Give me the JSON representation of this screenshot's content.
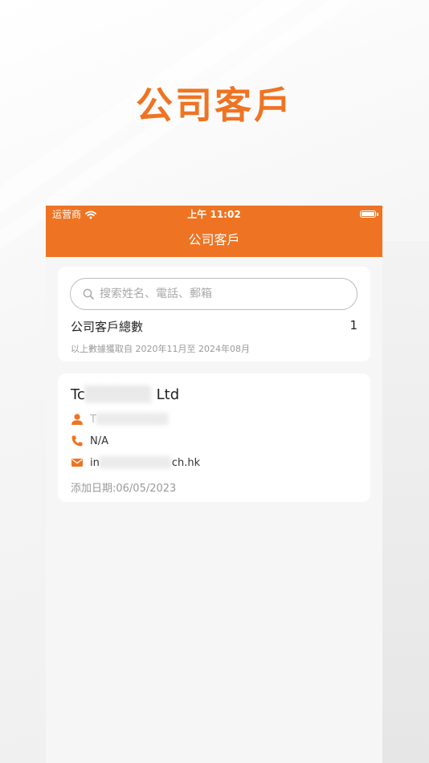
{
  "promo": {
    "title": "公司客戶"
  },
  "status_bar": {
    "carrier": "运营商",
    "time": "上午 11:02"
  },
  "nav": {
    "title": "公司客戶"
  },
  "search": {
    "placeholder": "搜索姓名、電話、郵箱",
    "value": ""
  },
  "summary": {
    "label": "公司客戶總數",
    "count": "1",
    "date_range": "以上數據獲取自 2020年11月至 2024年08月"
  },
  "client": {
    "name_visible_start": "Tc",
    "name_visible_end": "Ltd",
    "contact_visible": "T",
    "phone": "N/A",
    "email_visible_start": "in",
    "email_visible_end": "ch.hk",
    "added": "添加日期:06/05/2023"
  },
  "colors": {
    "accent": "#ee7423",
    "card": "#ffffff",
    "screen_background": "#f6f6f6",
    "muted_text": "#9a9a9a"
  },
  "icons": {
    "search": "search-icon",
    "wifi": "wifi-icon",
    "battery": "battery-icon",
    "contact": "person-icon",
    "phone": "phone-icon",
    "email": "email-icon"
  }
}
